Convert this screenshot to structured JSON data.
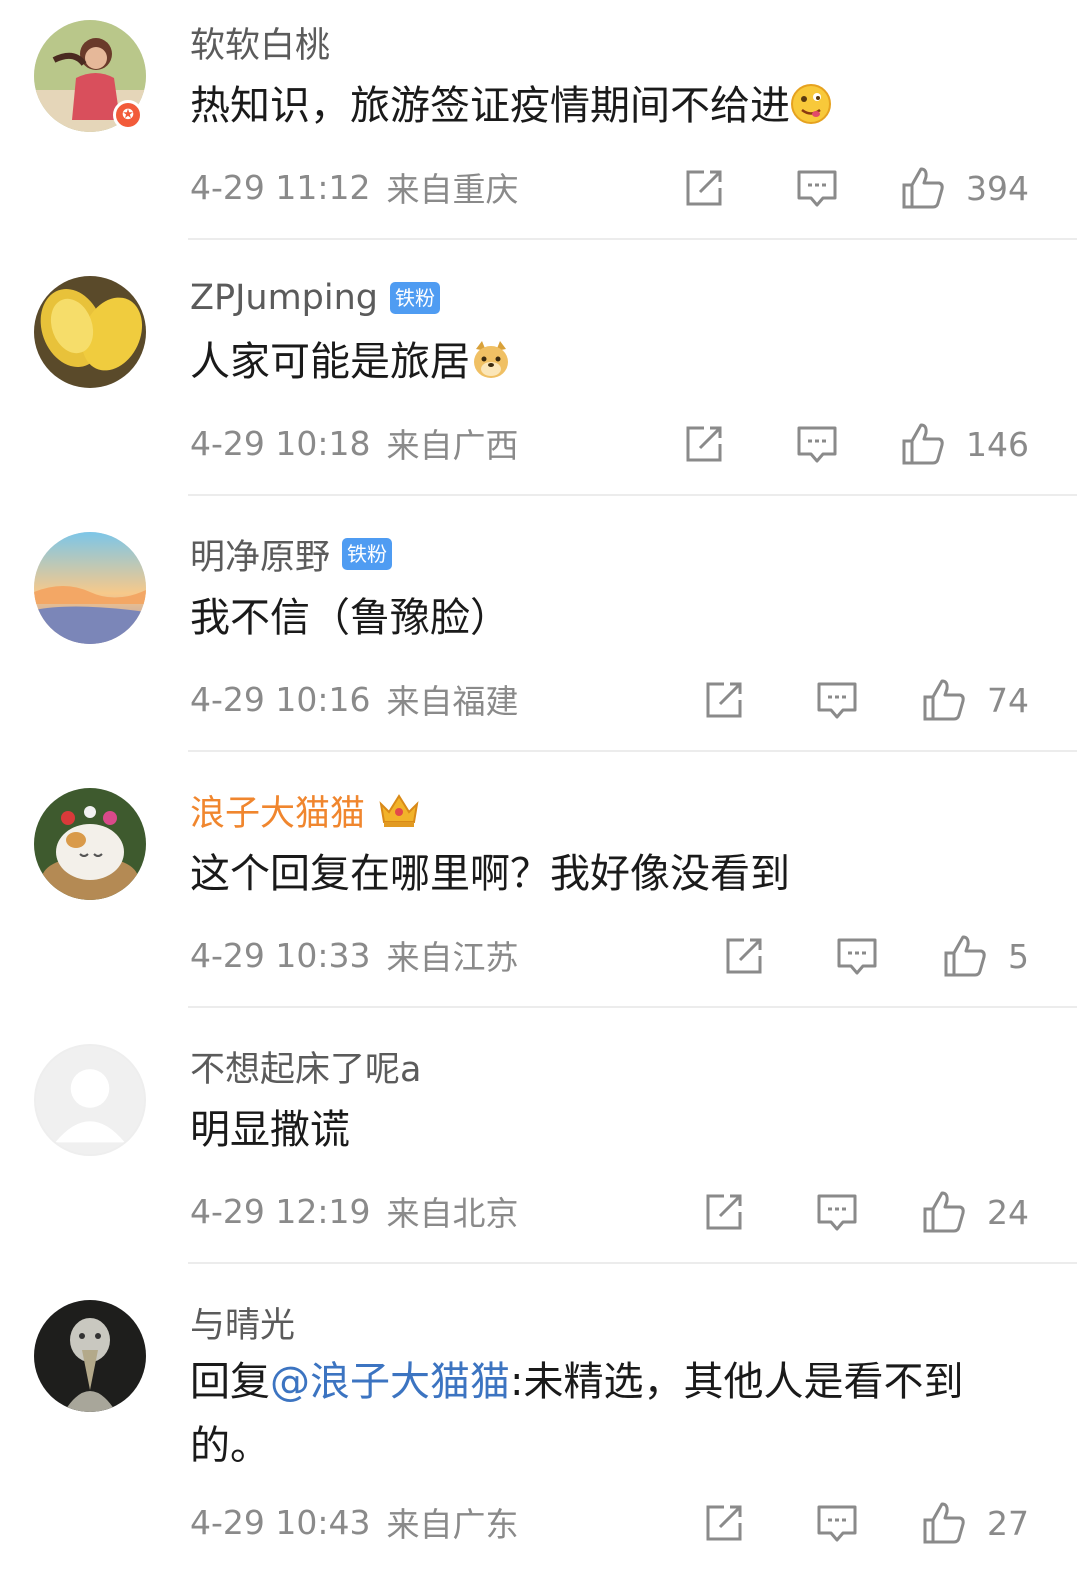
{
  "comments": [
    {
      "username": "软软白桃",
      "text": "热知识，旅游签证疫情期间不给进",
      "emoji": "drool-face",
      "time": "4-29 11:12",
      "location": "来自重庆",
      "likes": "394",
      "verified": true
    },
    {
      "username": "ZPJumping",
      "badge": "铁粉",
      "text": "人家可能是旅居",
      "emoji": "doge-face",
      "time": "4-29 10:18",
      "location": "来自广西",
      "likes": "146"
    },
    {
      "username": "明净原野",
      "badge": "铁粉",
      "text": "我不信（鲁豫脸）",
      "time": "4-29 10:16",
      "location": "来自福建",
      "likes": "74"
    },
    {
      "username": "浪子大猫猫",
      "crown": "crown-icon",
      "text": "这个回复在哪里啊？我好像没看到",
      "time": "4-29 10:33",
      "location": "来自江苏",
      "likes": "5"
    },
    {
      "username": "不想起床了呢a",
      "text": "明显撒谎",
      "time": "4-29 12:19",
      "location": "来自北京",
      "likes": "24"
    },
    {
      "username": "与晴光",
      "text_prefix": "回复",
      "mention": "@浪子大猫猫",
      "text_rest": ":未精选，其他人是看不到的。",
      "time": "4-29 10:43",
      "location": "来自广东",
      "likes": "27"
    }
  ],
  "colors": {
    "username": "#5b5b5b",
    "vip_username": "#f0862e",
    "mention": "#3c74c1",
    "fan_badge": "#4f9cf2",
    "meta": "#8a8a8a"
  },
  "icons": [
    "share-icon",
    "reply-icon",
    "like-icon"
  ]
}
